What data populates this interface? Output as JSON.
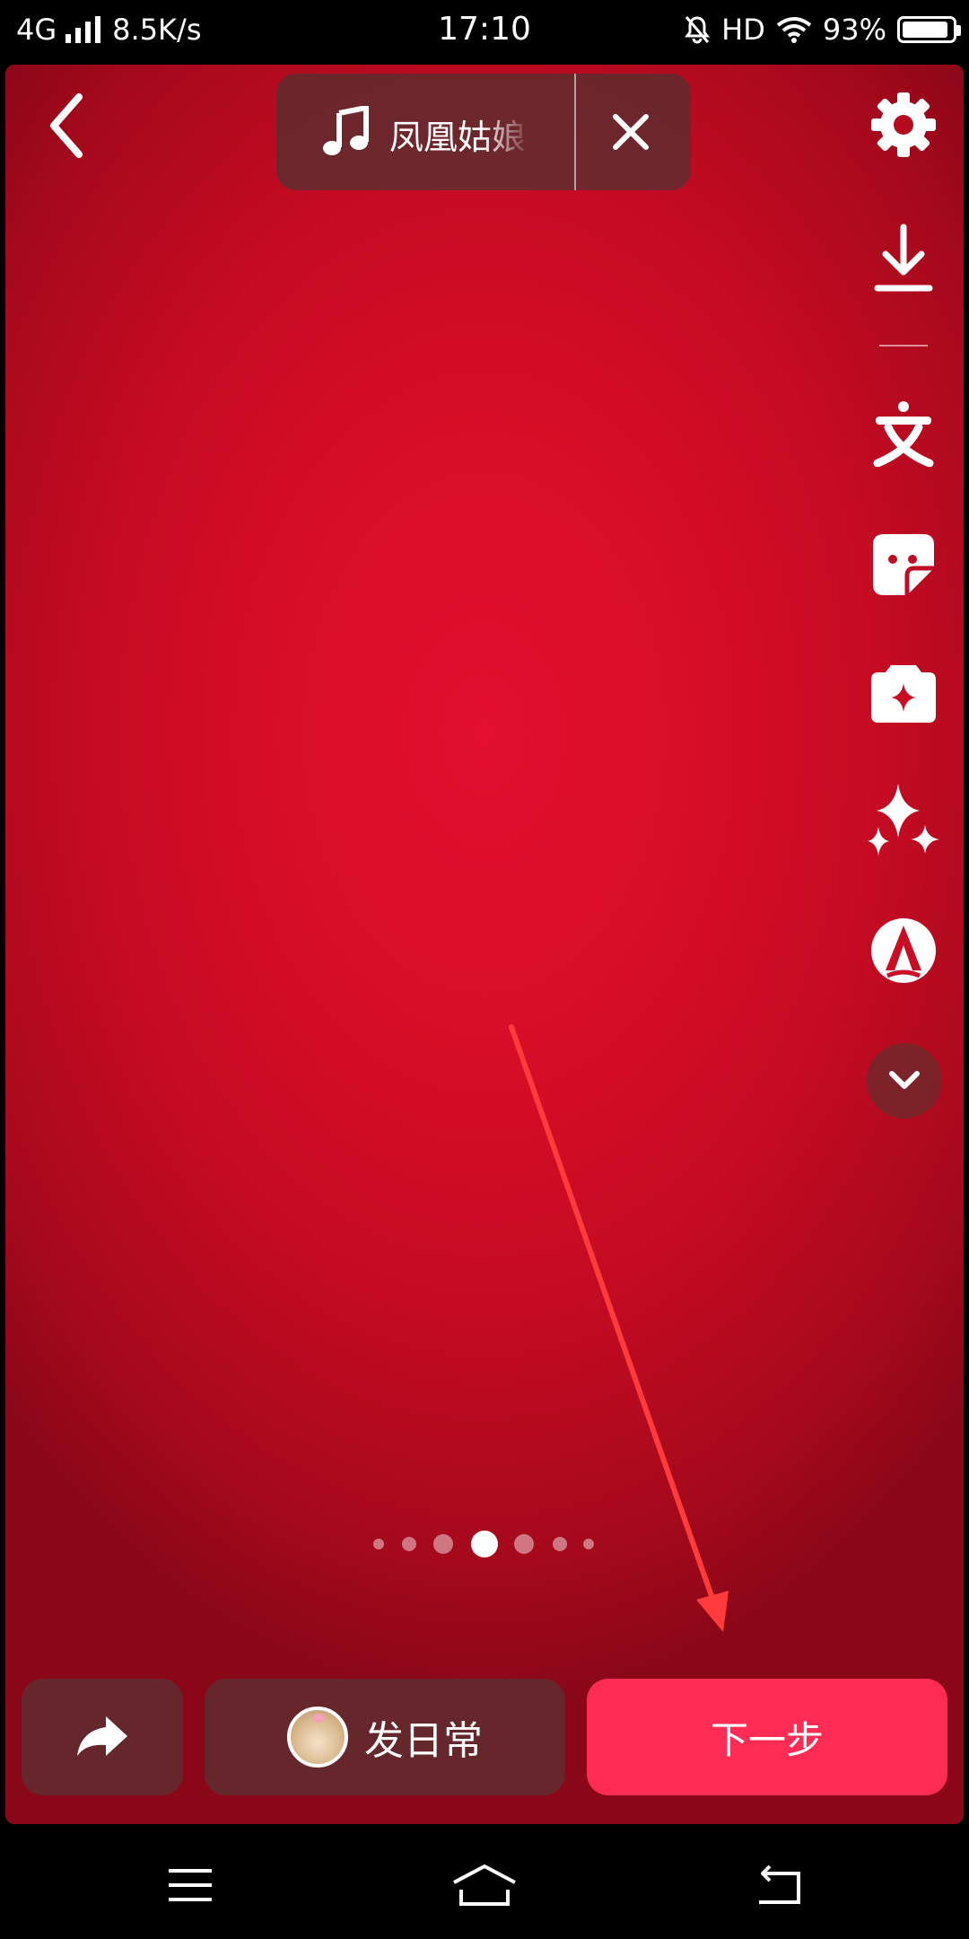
{
  "status_bar": {
    "network": "4G",
    "speed": "8.5K/s",
    "time": "17:10",
    "hd": "HD",
    "battery": "93%",
    "battery_level": 0.93
  },
  "music": {
    "title": "凤凰姑娘"
  },
  "toolbar": {
    "items": [
      "settings-icon",
      "download-icon",
      "text-icon",
      "sticker-icon",
      "effects-icon",
      "sparkle-icon",
      "font-icon",
      "chevron-down-icon"
    ]
  },
  "pager": {
    "count": 7,
    "active": 4
  },
  "bottom": {
    "daily_label": "发日常",
    "next_label": "下一步"
  },
  "colors": {
    "accent": "#fe2c55",
    "annotation": "#ff3b3b"
  }
}
